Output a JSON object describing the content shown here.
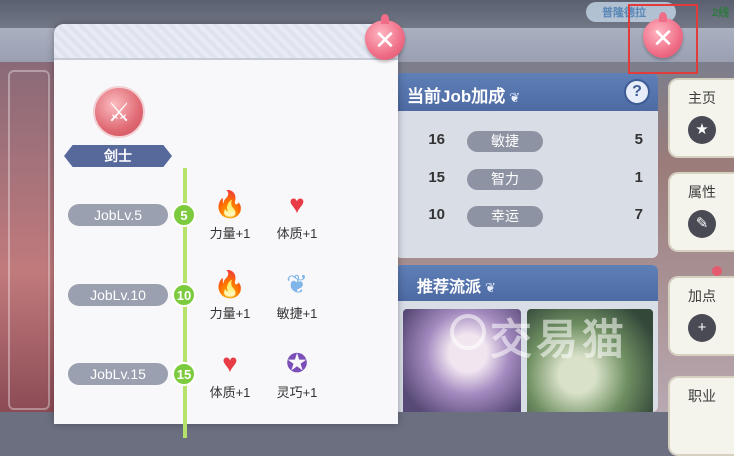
{
  "top_bar": {
    "text_left": "普隆德拉",
    "text_right": "2线"
  },
  "job": {
    "name": "剑士",
    "icon": "sword-icon"
  },
  "levels": [
    {
      "label": "JobLv.5",
      "num": "5",
      "bonuses": [
        {
          "label": "力量+1",
          "icon": "fire-icon"
        },
        {
          "label": "体质+1",
          "icon": "heart-icon"
        }
      ]
    },
    {
      "label": "JobLv.10",
      "num": "10",
      "bonuses": [
        {
          "label": "力量+1",
          "icon": "fire-icon"
        },
        {
          "label": "敏捷+1",
          "icon": "wing-icon"
        }
      ]
    },
    {
      "label": "JobLv.15",
      "num": "15",
      "bonuses": [
        {
          "label": "体质+1",
          "icon": "heart-icon"
        },
        {
          "label": "灵巧+1",
          "icon": "star-icon"
        }
      ]
    }
  ],
  "info_panel": {
    "title": "当前Job加成",
    "help": "?",
    "stats": [
      {
        "left_value": "16",
        "right_label": "敏捷",
        "right_value": "5"
      },
      {
        "left_value": "15",
        "right_label": "智力",
        "right_value": "1"
      },
      {
        "left_value": "10",
        "right_label": "幸运",
        "right_value": "7"
      }
    ]
  },
  "recommend_panel": {
    "title": "推荐流派"
  },
  "side_tabs": [
    {
      "label": "主页",
      "icon": "star-badge-icon"
    },
    {
      "label": "属性",
      "icon": "pencil-icon"
    },
    {
      "label": "加点",
      "icon": "plus-icon"
    },
    {
      "label": "职业",
      "icon": "job-icon"
    }
  ],
  "watermark": "交易猫",
  "colors": {
    "accent_pink": "#ef6d86",
    "panel_blue": "#5f7fb7",
    "timeline_green": "#7ccb3f"
  }
}
